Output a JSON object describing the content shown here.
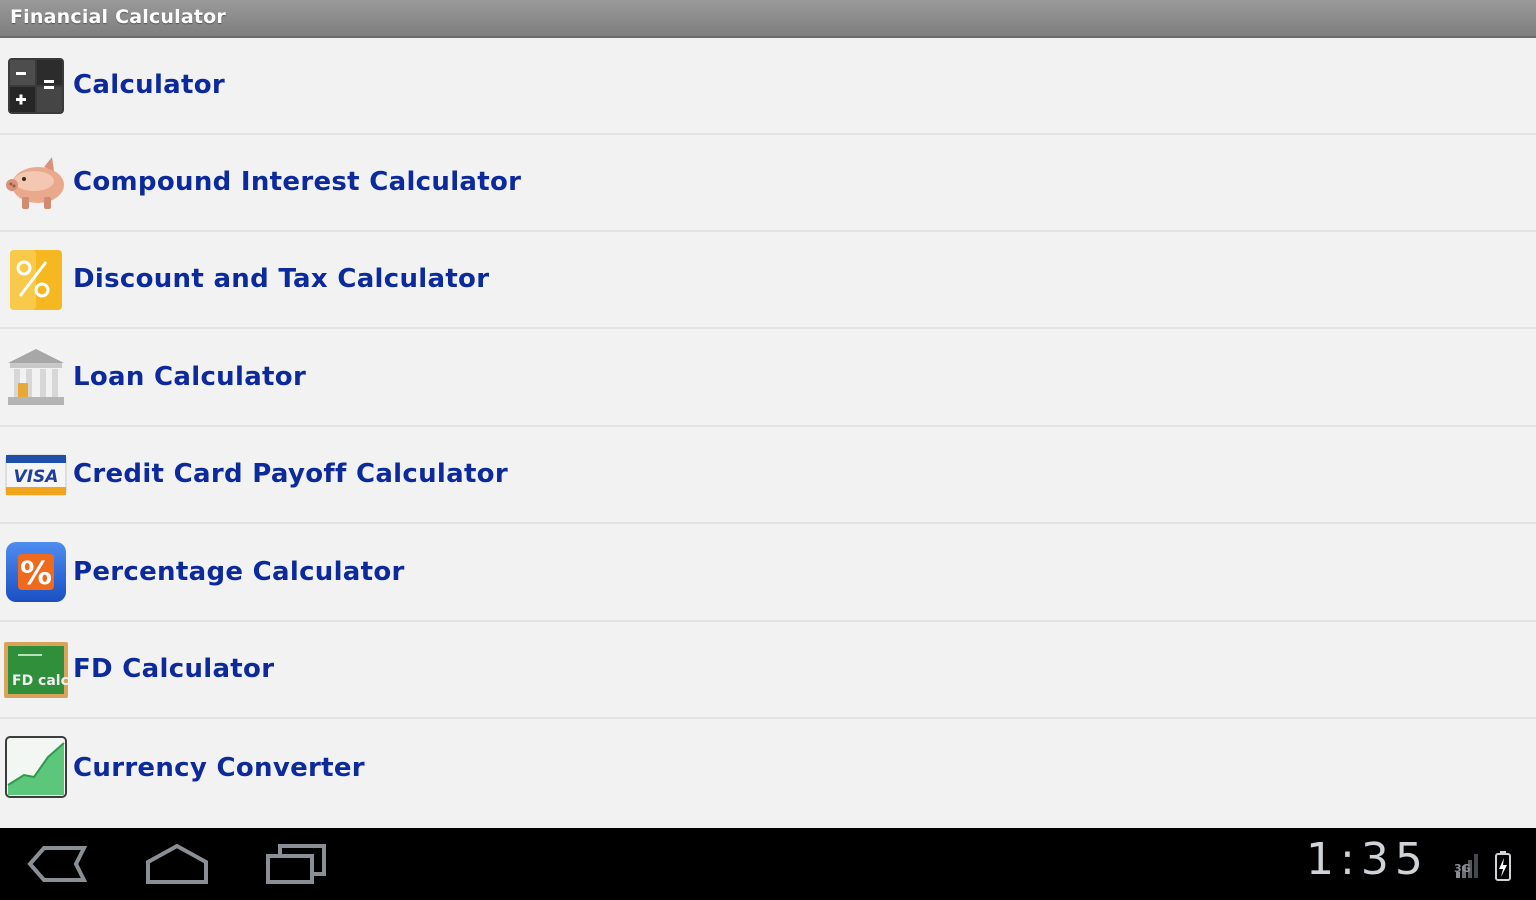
{
  "app": {
    "title": "Financial Calculator"
  },
  "menu": {
    "items": [
      {
        "label": "Calculator",
        "icon": "calculator-icon"
      },
      {
        "label": "Compound Interest Calculator",
        "icon": "piggy-bank-icon"
      },
      {
        "label": "Discount and Tax Calculator",
        "icon": "discount-tag-icon"
      },
      {
        "label": "Loan Calculator",
        "icon": "bank-icon"
      },
      {
        "label": "Credit Card Payoff Calculator",
        "icon": "visa-card-icon"
      },
      {
        "label": "Percentage Calculator",
        "icon": "percentage-icon"
      },
      {
        "label": "FD Calculator",
        "icon": "fd-board-icon"
      },
      {
        "label": "Currency Converter",
        "icon": "growth-chart-icon"
      }
    ]
  },
  "system_bar": {
    "time": "1:35",
    "network": "3G",
    "buttons": [
      "back-icon",
      "home-icon",
      "recent-apps-icon"
    ]
  },
  "colors": {
    "title_bar": "#8a8a8a",
    "list_background": "#f2f2f2",
    "item_text": "#0c2a9c",
    "nav_bar": "#000000"
  }
}
